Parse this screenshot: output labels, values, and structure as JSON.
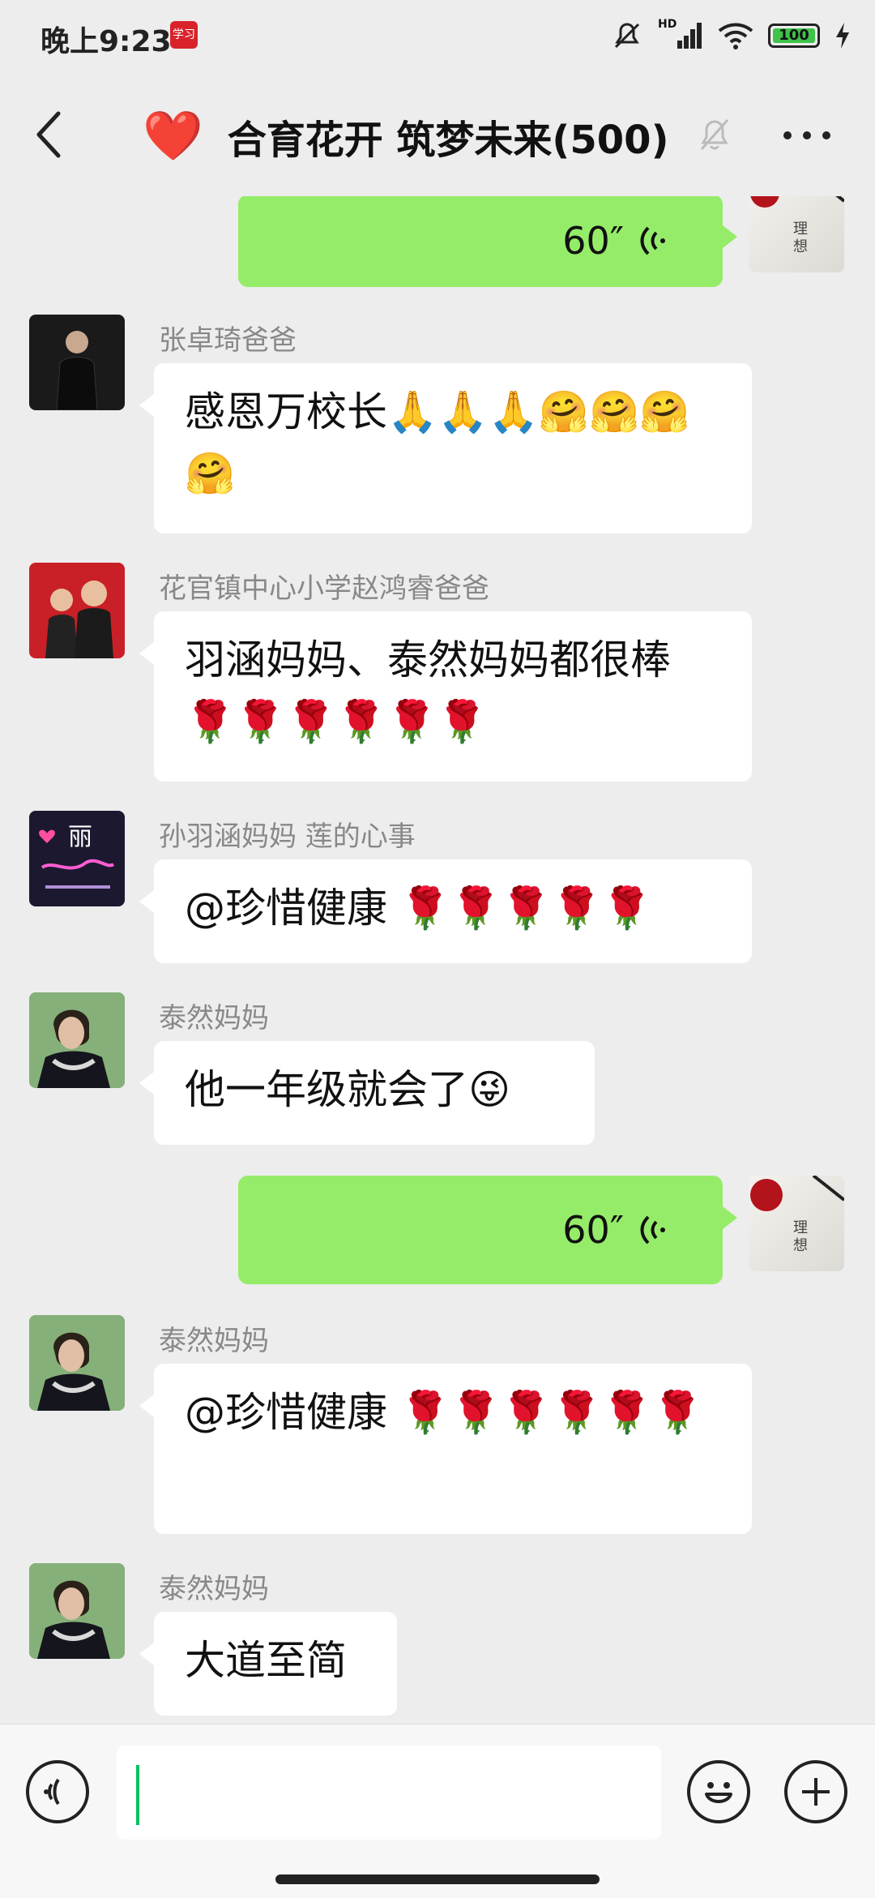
{
  "status_bar": {
    "time": "晚上9:23",
    "app_icon": "学习",
    "network": "HD",
    "battery": "100",
    "icons": [
      "mute-icon",
      "signal-icon",
      "wifi-icon",
      "battery-icon",
      "charging-icon"
    ]
  },
  "header": {
    "title": "合育花开 筑梦未来(500)",
    "title_emoji": "❤️",
    "muted": true
  },
  "messages": [
    {
      "side": "right",
      "type": "voice",
      "duration": "60″"
    },
    {
      "side": "left",
      "sender": "张卓琦爸爸",
      "text": "感恩万校长🙏🙏🙏🤗🤗🤗🤗"
    },
    {
      "side": "left",
      "sender": "花官镇中心小学赵鸿睿爸爸",
      "text": "羽涵妈妈、泰然妈妈都很棒🌹🌹🌹🌹🌹🌹"
    },
    {
      "side": "left",
      "sender": "孙羽涵妈妈  莲的心事",
      "text": "@珍惜健康 🌹🌹🌹🌹🌹"
    },
    {
      "side": "left",
      "sender": "泰然妈妈",
      "text": "他一年级就会了😜"
    },
    {
      "side": "right",
      "type": "voice",
      "duration": "60″"
    },
    {
      "side": "left",
      "sender": "泰然妈妈",
      "text": "@珍惜健康 🌹🌹🌹🌹🌹🌹"
    },
    {
      "side": "left",
      "sender": "泰然妈妈",
      "text": "大道至简"
    }
  ],
  "input_bar": {
    "voice_icon": "voice-input-icon",
    "emoji_icon": "emoji-icon",
    "plus_icon": "plus-icon",
    "text_value": ""
  },
  "colors": {
    "background": "#ededed",
    "bubble_self": "#95ec69",
    "bubble_other": "#ffffff",
    "accent": "#07c160"
  }
}
